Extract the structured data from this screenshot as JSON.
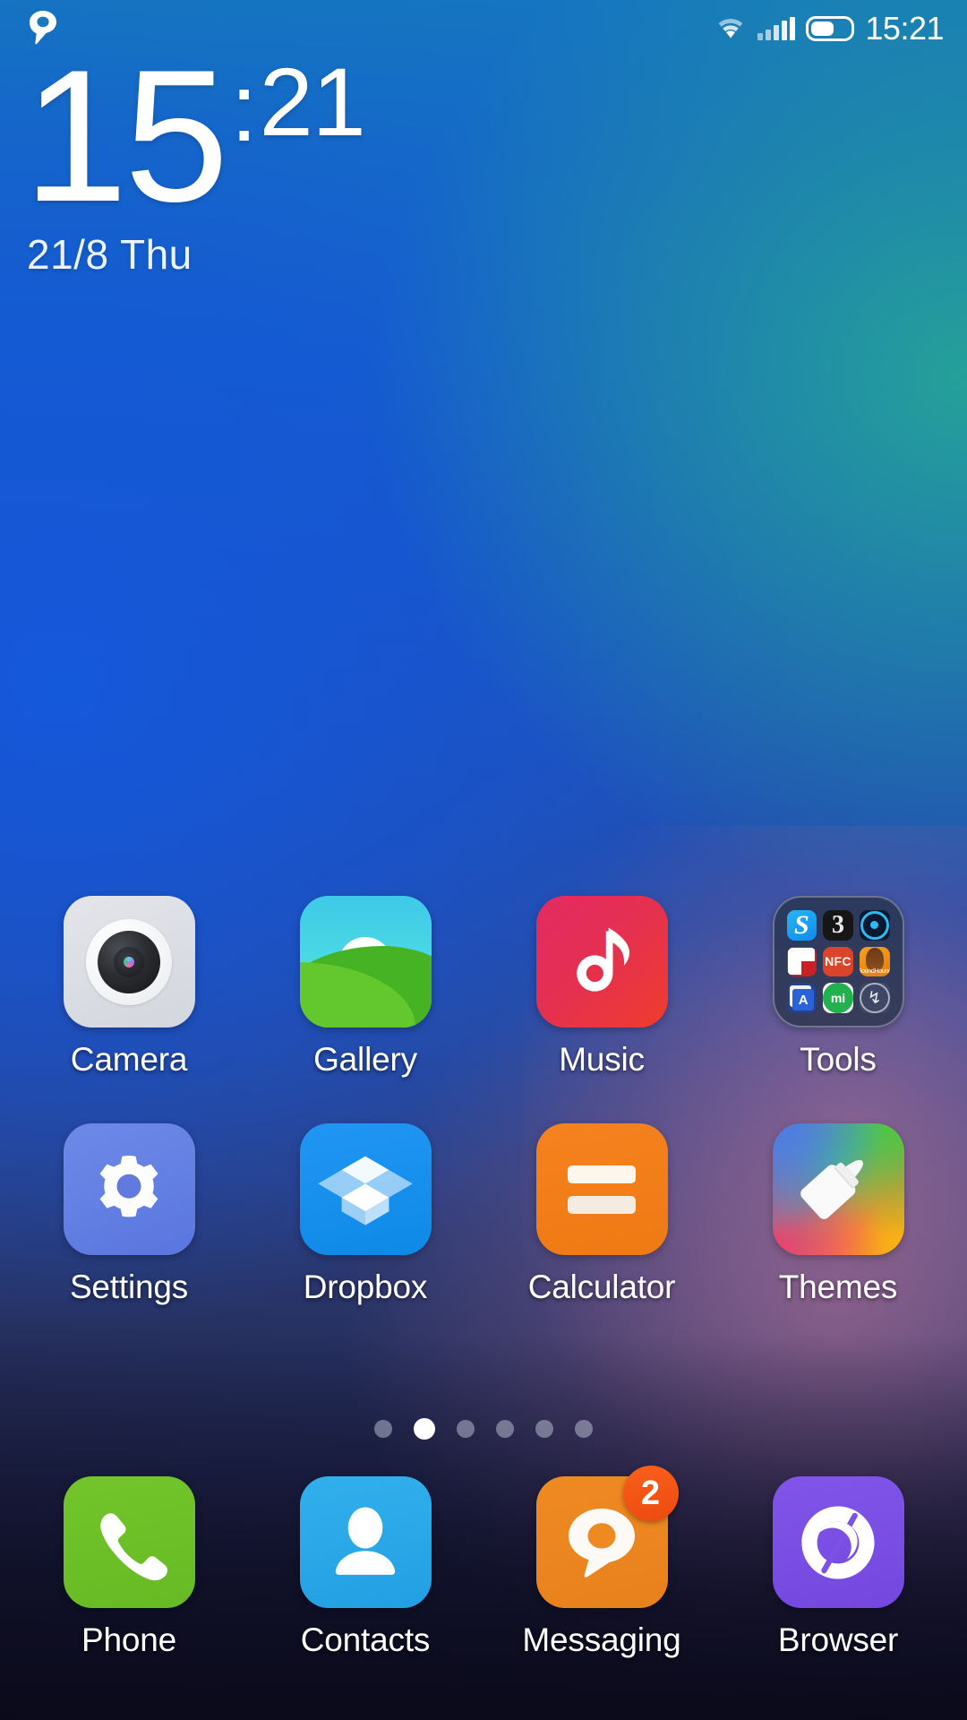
{
  "status_bar": {
    "notification_icon": "search-bubble-icon",
    "wifi_icon": "wifi-icon",
    "signal_icon": "signal-bars-icon",
    "battery_icon": "battery-icon",
    "battery_level_percent": 58,
    "time": "15:21"
  },
  "clock_widget": {
    "hours": "15",
    "separator": ":",
    "minutes": "21",
    "date": "21/8  Thu"
  },
  "app_grid": {
    "rows": [
      [
        {
          "label": "Camera",
          "icon": "camera-icon"
        },
        {
          "label": "Gallery",
          "icon": "gallery-icon"
        },
        {
          "label": "Music",
          "icon": "music-note-icon"
        },
        {
          "label": "Tools",
          "icon": "folder-icon"
        }
      ],
      [
        {
          "label": "Settings",
          "icon": "gear-icon"
        },
        {
          "label": "Dropbox",
          "icon": "dropbox-box-icon"
        },
        {
          "label": "Calculator",
          "icon": "equals-icon"
        },
        {
          "label": "Themes",
          "icon": "paintbrush-icon"
        }
      ]
    ]
  },
  "tools_folder": {
    "label": "Tools",
    "mini_apps": [
      {
        "name": "s-app-icon",
        "glyph": "S"
      },
      {
        "name": "three-app-icon",
        "glyph": "3"
      },
      {
        "name": "compass-app-icon",
        "glyph": ""
      },
      {
        "name": "flipboard-icon",
        "glyph": ""
      },
      {
        "name": "nfc-icon",
        "glyph": "NFC"
      },
      {
        "name": "soundhound-icon",
        "glyph": "SoundHound"
      },
      {
        "name": "translate-icon",
        "glyph_left": "文",
        "glyph_right": "A"
      },
      {
        "name": "mi-chat-icon",
        "glyph": "mi"
      },
      {
        "name": "flash-transfer-icon",
        "glyph": "↯"
      }
    ]
  },
  "page_indicator": {
    "total_pages": 6,
    "active_page": 2
  },
  "dock": {
    "items": [
      {
        "label": "Phone",
        "icon": "phone-handset-icon",
        "badge": null
      },
      {
        "label": "Contacts",
        "icon": "person-icon",
        "badge": null
      },
      {
        "label": "Messaging",
        "icon": "speech-bubble-icon",
        "badge": "2"
      },
      {
        "label": "Browser",
        "icon": "swirl-icon",
        "badge": null
      }
    ]
  },
  "colors": {
    "accent_blue": "#1560cd",
    "accent_teal": "#26a496",
    "badge_orange": "#f9601a",
    "camera_gray": "#e3e5ea",
    "gallery_cyan": "#4ad9e3",
    "gallery_green": "#63c82e",
    "music_red": "#e53050",
    "settings_periwinkle": "#6d8ae8",
    "dropbox_blue": "#2196f3",
    "calculator_orange": "#f5821f",
    "phone_green": "#73c52b",
    "contacts_blue": "#31b0ec",
    "messaging_orange": "#ef8a23",
    "browser_purple": "#8155e8"
  }
}
